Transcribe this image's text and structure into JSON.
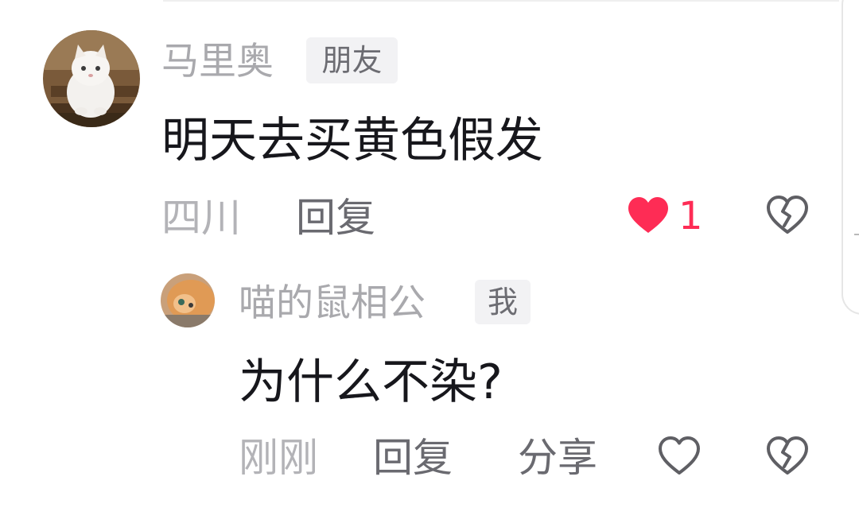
{
  "comment": {
    "author": "马里奥",
    "author_tag": "朋友",
    "text": "明天去买黄色假发",
    "location": "四川",
    "reply_label": "回复",
    "like_count": "1",
    "liked": true,
    "avatar_icon": "white-cat-avatar",
    "like_icon": "heart-filled-icon",
    "dislike_icon": "broken-heart-icon",
    "like_color": "#fe2c55"
  },
  "reply": {
    "author": "喵的鼠相公",
    "author_tag": "我",
    "text": "为什么不染?",
    "time": "刚刚",
    "reply_label": "回复",
    "share_label": "分享",
    "liked": false,
    "avatar_icon": "orange-cat-avatar",
    "like_icon": "heart-outline-icon",
    "dislike_icon": "broken-heart-icon"
  }
}
